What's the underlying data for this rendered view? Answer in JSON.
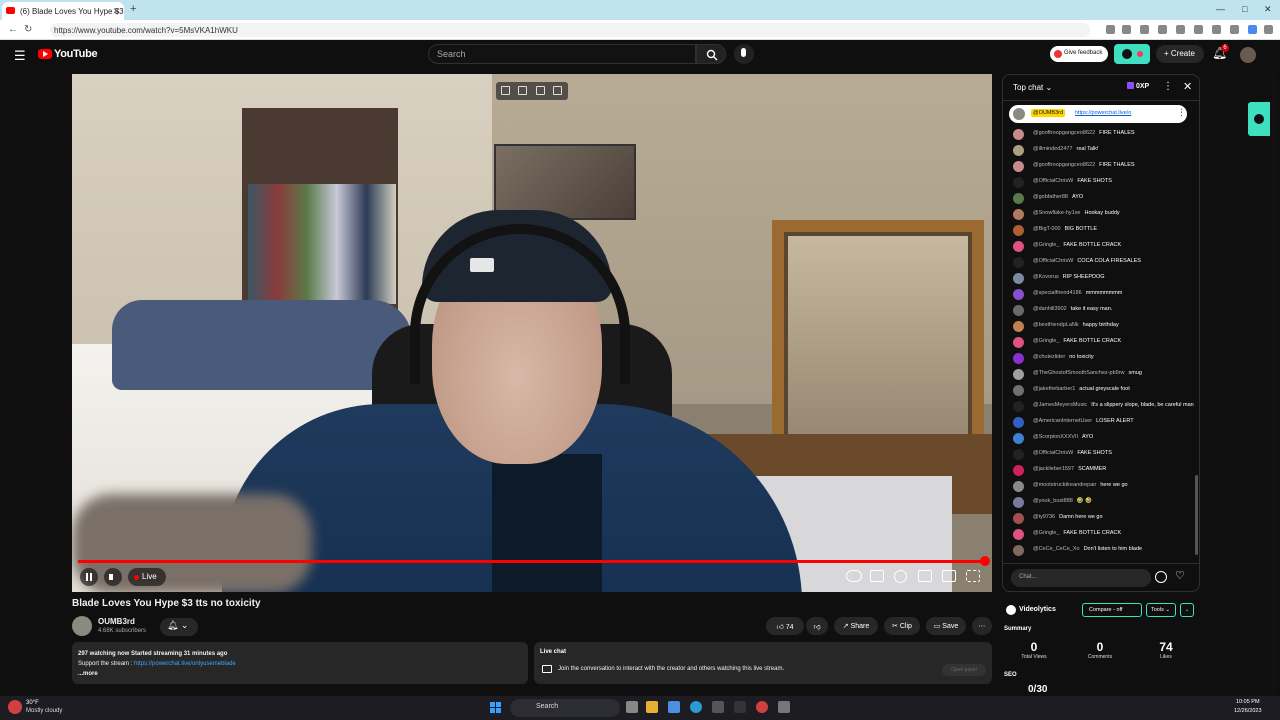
{
  "browser": {
    "tab_title": "(6) Blade Loves You Hype $3 t",
    "new_tab": "+",
    "url": "https://www.youtube.com/watch?v=5MsVKA1hWKU"
  },
  "yt_header": {
    "logo_text": "YouTube",
    "search_placeholder": "Search",
    "feedback_label": "Give feedback",
    "create_label": "Create",
    "notification_count": "6"
  },
  "video": {
    "title": "Blade Loves You Hype $3 tts no toxicity",
    "live_label": "Live",
    "progress": 1.0
  },
  "channel": {
    "name": "OUMB3rd",
    "subscribers": "4.68K subscribers"
  },
  "actions": {
    "likes": "74",
    "share": "Share",
    "clip": "Clip",
    "save": "Save"
  },
  "description": {
    "stats": "297 watching now  Started streaming 31 minutes ago",
    "support_prefix": "Support the stream : ",
    "support_link": "https://powerchat.live/onlyusemeblade",
    "more": "...more"
  },
  "live_chat_box": {
    "title": "Live chat",
    "text": "Join the conversation to interact with the creator and others watching this live stream.",
    "open_panel": "Open panel"
  },
  "chat": {
    "mode": "Top chat",
    "xp": "0XP",
    "pinned_author": "@OUMB3rd",
    "pinned_link": "https://powerchat.live/o",
    "input_placeholder": "Chat...",
    "messages": [
      {
        "author": "@gooftroopgangceo8622",
        "text": "FIRE THALES",
        "color": "#c98a8a"
      },
      {
        "author": "@illminded2477",
        "text": "real Talk!",
        "color": "#a8a080"
      },
      {
        "author": "@gooftroopgangceo8622",
        "text": "FIRE THALES",
        "color": "#c98a8a"
      },
      {
        "author": "@OfficialChrisW",
        "text": "FAKE SHOTS",
        "color": "#222"
      },
      {
        "author": "@gobfather88",
        "text": "AYO",
        "color": "#5a7a4a"
      },
      {
        "author": "@Snowflake-hy1xe",
        "text": "Hookay buddy",
        "color": "#b07a60"
      },
      {
        "author": "@BigT-000",
        "text": "BIG BOTTLE",
        "color": "#b06030"
      },
      {
        "author": "@Gringle_",
        "text": "FAKE BOTTLE CRACK",
        "color": "#e05080"
      },
      {
        "author": "@OfficialChrisW",
        "text": "COCA COLA FIRESALES",
        "color": "#222"
      },
      {
        "author": "@Kovorus",
        "text": "RIP SHEEPDOG",
        "color": "#7a8aa0"
      },
      {
        "author": "@specialfriend4186",
        "text": "mmmmmmmm",
        "color": "#8a4fd0"
      },
      {
        "author": "@danhill3902",
        "text": "take it easy man.",
        "color": "#6a6a6a"
      },
      {
        "author": "@bestfriendpLaNk",
        "text": "happy birthday",
        "color": "#c08050"
      },
      {
        "author": "@Gringle_",
        "text": "FAKE BOTTLE CRACK",
        "color": "#e05080"
      },
      {
        "author": "@chutezlider",
        "text": "no toxicity",
        "color": "#8a2fd0"
      },
      {
        "author": "@TheGhostofSmoothSanchez-pb9rw",
        "text": "smug",
        "color": "#a0a0a0"
      },
      {
        "author": "@jakethebarber1",
        "text": "actual greyscale foot",
        "color": "#707070"
      },
      {
        "author": "@JamesMeyersMusic",
        "text": "It's a slippery slope, blade, be careful man",
        "color": "#222"
      },
      {
        "author": "@AmericanInternetUser",
        "text": "LOSER ALERT",
        "color": "#3060c0"
      },
      {
        "author": "@ScorpionXXXVII",
        "text": "AYO",
        "color": "#4080d0"
      },
      {
        "author": "@OfficialChrisW",
        "text": "FAKE SHOTS",
        "color": "#222"
      },
      {
        "author": "@jacklieber1597",
        "text": "SCAMMER",
        "color": "#d02060"
      },
      {
        "author": "@mootstrucktireandrepair",
        "text": "here we go",
        "color": "#8a8a8a"
      },
      {
        "author": "@youk_bust888",
        "text": "🤣 🤣",
        "color": "#7a7aa0"
      },
      {
        "author": "@ty9736",
        "text": "Damn here we go",
        "color": "#a05050"
      },
      {
        "author": "@Gringle_",
        "text": "FAKE BOTTLE CRACK",
        "color": "#e05080"
      },
      {
        "author": "@CeCe_CeCe_Xo",
        "text": "Don't listen to him blade",
        "color": "#806a60"
      }
    ]
  },
  "videolytics": {
    "title": "Videolytics",
    "compare": "Compare - off",
    "tools": "Tools",
    "summary": "Summary",
    "total_views": "0",
    "total_views_label": "Total Views",
    "comments": "0",
    "comments_label": "Comments",
    "likes": "74",
    "likes_label": "Likes",
    "seo": "SEO",
    "seo_partial": "0/30"
  },
  "taskbar": {
    "temp": "30°F",
    "weather": "Mostly cloudy",
    "search": "Search",
    "time": "10:05 PM",
    "date": "12/26/2023"
  }
}
